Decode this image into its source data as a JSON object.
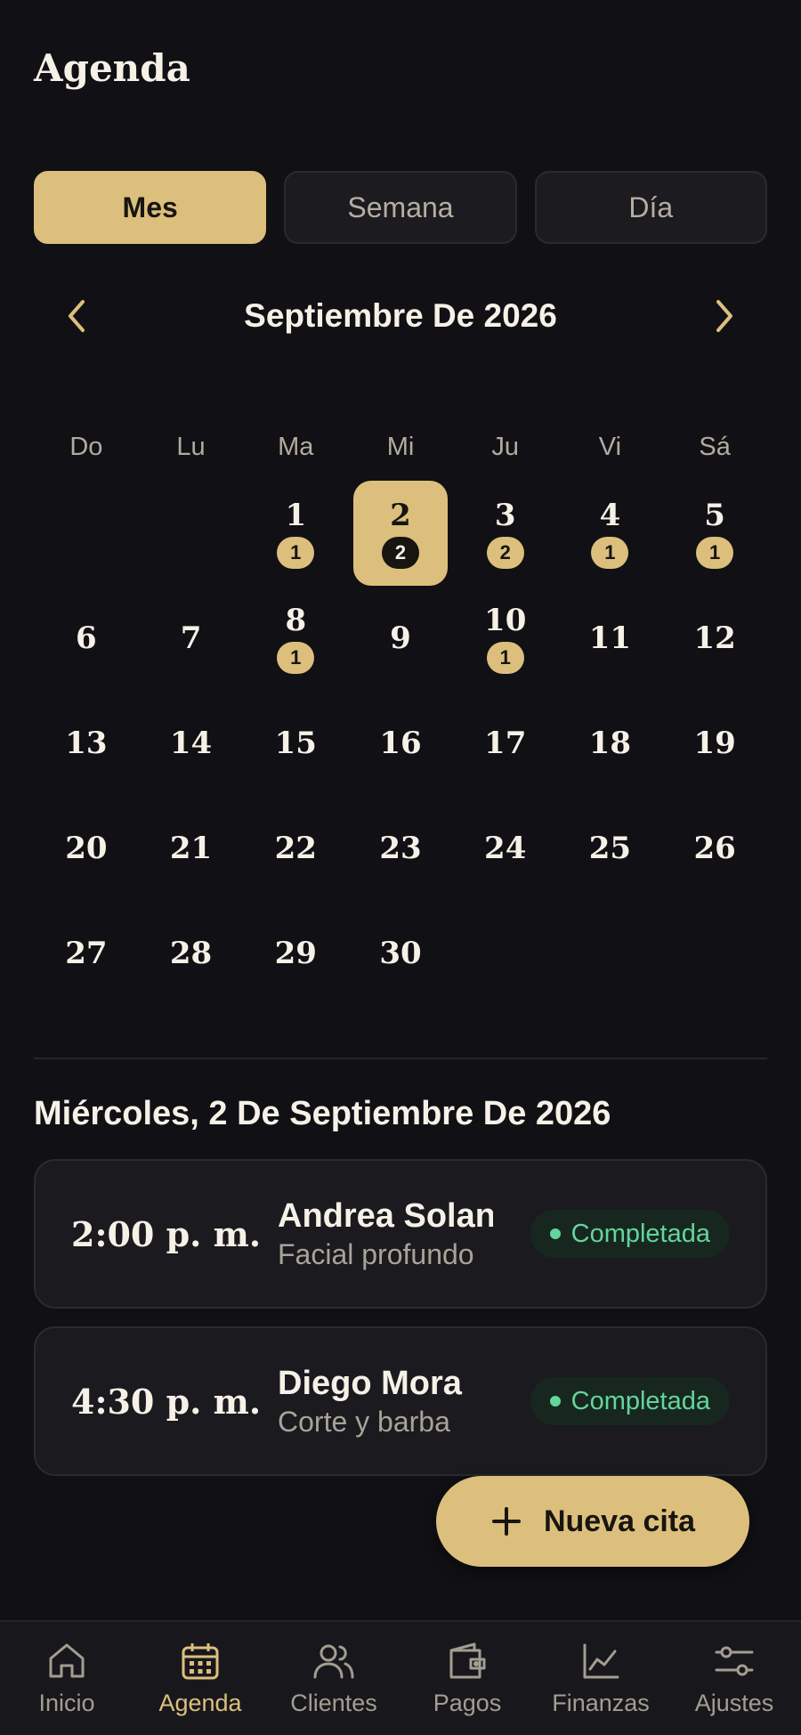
{
  "header": {
    "title": "Agenda"
  },
  "view_tabs": [
    {
      "label": "Mes",
      "active": true
    },
    {
      "label": "Semana",
      "active": false
    },
    {
      "label": "Día",
      "active": false
    }
  ],
  "month": {
    "title": "Septiembre De 2026",
    "prev_icon": "chevron-left-icon",
    "next_icon": "chevron-right-icon"
  },
  "weekdays": [
    "Do",
    "Lu",
    "Ma",
    "Mi",
    "Ju",
    "Vi",
    "Sá"
  ],
  "calendar": {
    "leading_blanks": 2,
    "selected_day": 2,
    "days": [
      {
        "day": "1",
        "count": "1"
      },
      {
        "day": "2",
        "count": "2"
      },
      {
        "day": "3",
        "count": "2"
      },
      {
        "day": "4",
        "count": "1"
      },
      {
        "day": "5",
        "count": "1"
      },
      {
        "day": "6",
        "count": ""
      },
      {
        "day": "7",
        "count": ""
      },
      {
        "day": "8",
        "count": "1"
      },
      {
        "day": "9",
        "count": ""
      },
      {
        "day": "10",
        "count": "1"
      },
      {
        "day": "11",
        "count": ""
      },
      {
        "day": "12",
        "count": ""
      },
      {
        "day": "13",
        "count": ""
      },
      {
        "day": "14",
        "count": ""
      },
      {
        "day": "15",
        "count": ""
      },
      {
        "day": "16",
        "count": ""
      },
      {
        "day": "17",
        "count": ""
      },
      {
        "day": "18",
        "count": ""
      },
      {
        "day": "19",
        "count": ""
      },
      {
        "day": "20",
        "count": ""
      },
      {
        "day": "21",
        "count": ""
      },
      {
        "day": "22",
        "count": ""
      },
      {
        "day": "23",
        "count": ""
      },
      {
        "day": "24",
        "count": ""
      },
      {
        "day": "25",
        "count": ""
      },
      {
        "day": "26",
        "count": ""
      },
      {
        "day": "27",
        "count": ""
      },
      {
        "day": "28",
        "count": ""
      },
      {
        "day": "29",
        "count": ""
      },
      {
        "day": "30",
        "count": ""
      }
    ]
  },
  "selected_date_heading": "Miércoles, 2 De Septiembre De 2026",
  "appointments": [
    {
      "time": "2:00 p. m.",
      "client": "Andrea Solano",
      "service": "Facial profundo",
      "status": "Completada"
    },
    {
      "time": "4:30 p. m.",
      "client": "Diego Mora",
      "service": "Corte y barba",
      "status": "Completada"
    }
  ],
  "fab": {
    "label": "Nueva cita",
    "icon": "plus-icon"
  },
  "nav": [
    {
      "label": "Inicio",
      "icon": "home-icon",
      "active": false
    },
    {
      "label": "Agenda",
      "icon": "calendar-icon",
      "active": true
    },
    {
      "label": "Clientes",
      "icon": "users-icon",
      "active": false
    },
    {
      "label": "Pagos",
      "icon": "wallet-icon",
      "active": false
    },
    {
      "label": "Finanzas",
      "icon": "chart-icon",
      "active": false
    },
    {
      "label": "Ajustes",
      "icon": "sliders-icon",
      "active": false
    }
  ],
  "colors": {
    "background": "#111014",
    "accent": "#dcbf7d",
    "status_completed": "#63d59a"
  }
}
